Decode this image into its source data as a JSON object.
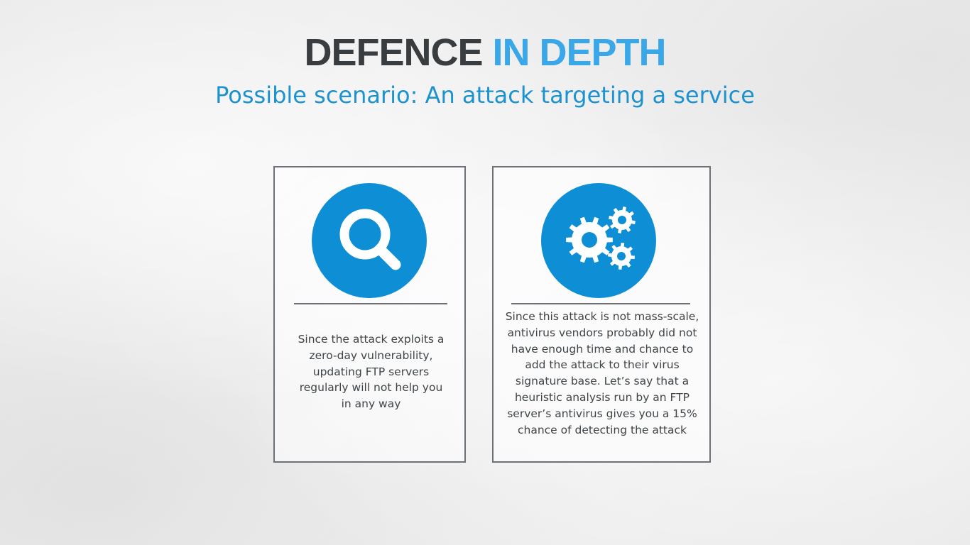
{
  "title": {
    "part1": "DEFENCE",
    "part2": "IN DEPTH"
  },
  "subtitle": "Possible scenario: An attack targeting a service",
  "cards": [
    {
      "icon": "magnifier-icon",
      "text": "Since the attack exploits a zero-day vulnerability, updating FTP servers regularly will not help you in any way"
    },
    {
      "icon": "gears-icon",
      "text": "Since this attack is not mass-scale, antivirus vendors probably did not have enough time and chance to add the attack to their virus signature base. Let’s say that a heuristic analysis run by an FTP server’s antivirus gives you a 15% chance of detecting the attack"
    }
  ],
  "colors": {
    "title_dark": "#3a3d40",
    "title_accent": "#3aa7e8",
    "subtitle": "#1c92cf",
    "icon_circle": "#0e8ed4",
    "card_border": "#6b7176",
    "card_text": "#3e4448"
  }
}
